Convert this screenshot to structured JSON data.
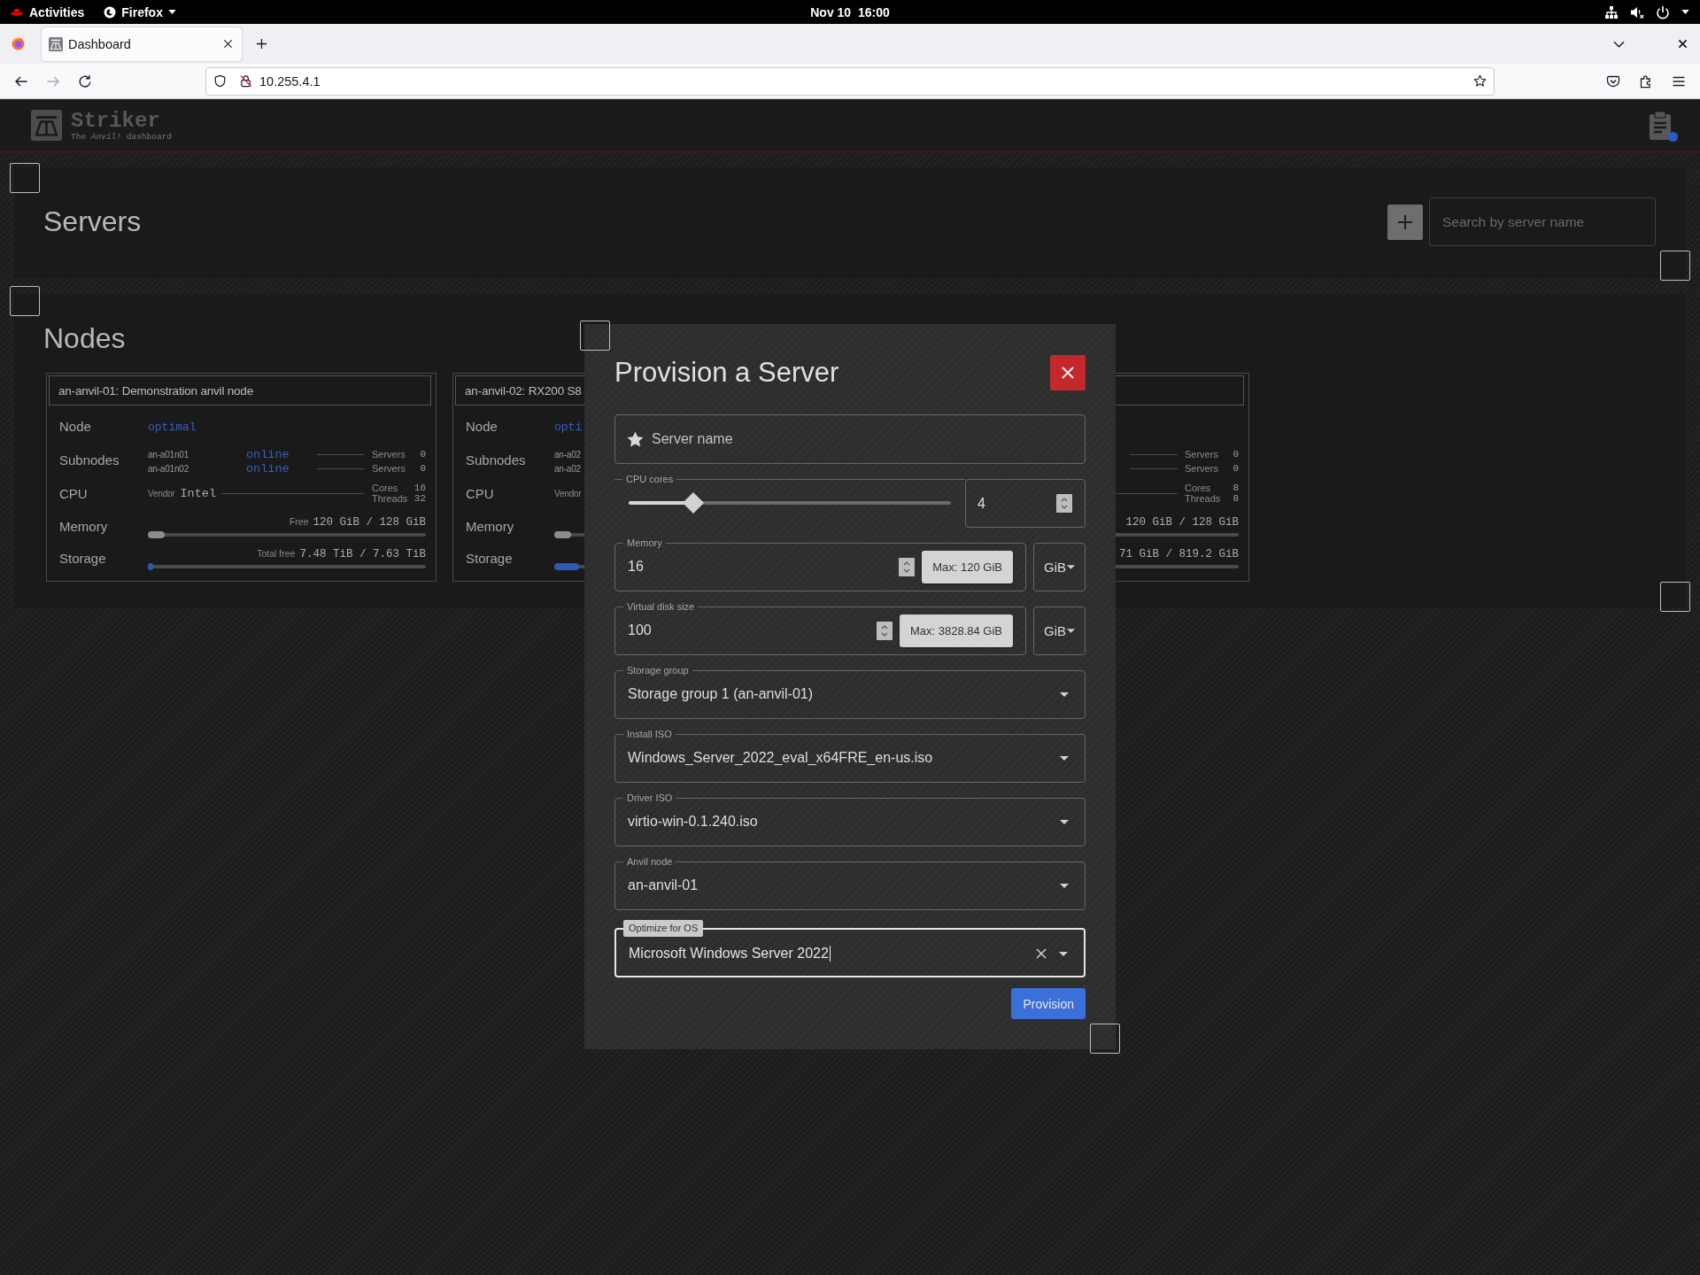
{
  "system_bar": {
    "activities": "Activities",
    "app_menu": "Firefox",
    "clock": "Nov 10  16:00"
  },
  "browser": {
    "tabs": [
      {
        "title": "Dashboard",
        "selected": true
      }
    ],
    "nav": [
      {
        "kind": "back",
        "disabled": false
      },
      {
        "kind": "forward",
        "disabled": true
      },
      {
        "kind": "reload",
        "disabled": false
      }
    ],
    "url": "10.255.4.1"
  },
  "app_header": {
    "title": "Striker",
    "subtitle": "The *Anvil!* dashboard",
    "notice_dot": true
  },
  "servers_panel": {
    "heading": "Servers",
    "search": {
      "placeholder": "Search by server name"
    }
  },
  "nodes_panel": {
    "heading": "Nodes",
    "nodes": [
      {
        "title": "an-anvil-01: Demonstration anvil node",
        "labels": [
          "Node",
          "Subnodes",
          "CPU",
          "Memory",
          "Storage"
        ],
        "status": "optimal",
        "subnodes": [
          {
            "name": "an-a01n01",
            "status": "online",
            "servers_label": "Servers",
            "servers": "0"
          },
          {
            "name": "an-a01n02",
            "status": "online",
            "servers_label": "Servers",
            "servers": "0"
          }
        ],
        "cpu": {
          "vendor_label": "Vendor",
          "vendor": "Intel",
          "cores_label": "Cores",
          "cores": "16",
          "threads_label": "Threads",
          "threads": "32"
        },
        "memory": {
          "free_label": "Free",
          "amount": "120 GiB / 128 GiB",
          "level": 0.06
        },
        "storage": {
          "free_label": "Total free",
          "amount": "7.48 TiB / 7.63 TiB",
          "level": 0.02
        }
      },
      {
        "title": "an-anvil-02: RX200 S8",
        "labels": [
          "Node",
          "Subnodes",
          "CPU",
          "Memory",
          "Storage"
        ],
        "status": "opti",
        "subnodes": [
          {
            "name": "an-a02"
          },
          {
            "name": "an-a02"
          }
        ],
        "cpu": {
          "vendor_label": "Vendor"
        },
        "memory": {
          "level": 0.06
        },
        "storage": {
          "level": 0.09
        }
      },
      {
        "subnodes": [
          {
            "servers_label": "Servers",
            "servers": "0"
          },
          {
            "servers_label": "Servers",
            "servers": "0"
          }
        ],
        "cpu": {
          "cores_label": "Cores",
          "cores": "8",
          "threads_label": "Threads",
          "threads": "8"
        },
        "memory": {
          "amount": "120 GiB / 128 GiB"
        },
        "storage": {
          "amount": "71 GiB / 819.2 GiB"
        }
      }
    ]
  },
  "dialog": {
    "title": "Provision a Server",
    "fields": [
      {
        "kind": "text",
        "placeholder": "Server name",
        "focused": false
      },
      {
        "kind": "slider",
        "label": "CPU cores",
        "level": 0.2,
        "value": "4",
        "focused": false
      },
      {
        "kind": "size",
        "label": "Memory",
        "value": "16",
        "max_button": "Max: 120 GiB",
        "unit": "GiB",
        "focused": false
      },
      {
        "kind": "size",
        "label": "Virtual disk size",
        "value": "100",
        "max_button": "Max: 3828.84 GiB",
        "unit": "GiB",
        "focused": false
      },
      {
        "kind": "select",
        "label": "Storage group",
        "value": "Storage group 1 (an-anvil-01)",
        "focused": false
      },
      {
        "kind": "select",
        "label": "Install ISO",
        "value": "Windows_Server_2022_eval_x64FRE_en-us.iso",
        "focused": false
      },
      {
        "kind": "select",
        "label": "Driver ISO",
        "value": "virtio-win-0.1.240.iso",
        "focused": false
      },
      {
        "kind": "select",
        "label": "Anvil node",
        "value": "an-anvil-01",
        "focused": false
      },
      {
        "kind": "autocomplete",
        "label": "Optimize for OS",
        "value": "Microsoft Windows Server 2022",
        "focused": true
      }
    ],
    "submit": "Provision"
  }
}
